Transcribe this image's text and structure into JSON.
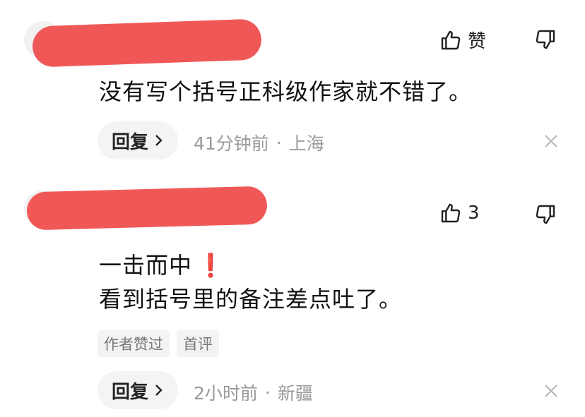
{
  "comments": [
    {
      "like_label": "赞",
      "text": "没有写个括号正科级作家就不错了。",
      "reply_label": "回复",
      "time": "41分钟前",
      "separator": "·",
      "location": "上海"
    },
    {
      "like_count": "3",
      "line1": "一击而中",
      "line1_mark": "❗",
      "line2": "看到括号里的备注差点吐了。",
      "tags": [
        "作者赞过",
        "首评"
      ],
      "reply_label": "回复",
      "time": "2小时前",
      "separator": "·",
      "location": "新疆"
    }
  ],
  "colors": {
    "redaction": "#ef4f4f",
    "meta_text": "#9a9a9a",
    "warn": "#e12b2b"
  },
  "icons": [
    "thumbs-up-icon",
    "thumbs-down-icon",
    "chevron-right-icon",
    "close-icon"
  ]
}
